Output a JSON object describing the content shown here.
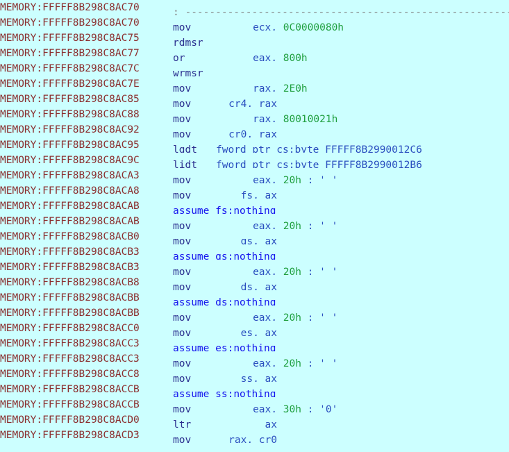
{
  "view": {
    "name": "IDA View disassembly listing",
    "segment": "MEMORY",
    "background_color": "#ccffff",
    "colors": {
      "address": "#8b2f2f",
      "mnemonic": "#2a2f8f",
      "operand": "#2a4fbf",
      "number": "#1f9f3f",
      "directive": "#1515ee",
      "comment": "#808080"
    }
  },
  "lines": [
    {
      "address": "MEMORY:FFFFF8B298C8AC70",
      "kind": "comment",
      "mnemonic": "",
      "operands": "",
      "comment": "; ----------------------------------------------------------"
    },
    {
      "address": "MEMORY:FFFFF8B298C8AC70",
      "kind": "instruction",
      "mnemonic": "mov",
      "operands_reg": "ecx,",
      "operands_num": "0C0000080h",
      "comment": ""
    },
    {
      "address": "MEMORY:FFFFF8B298C8AC75",
      "kind": "instruction",
      "mnemonic": "rdmsr",
      "operands_reg": "",
      "operands_num": "",
      "comment": ""
    },
    {
      "address": "MEMORY:FFFFF8B298C8AC77",
      "kind": "instruction",
      "mnemonic": "or",
      "operands_reg": "eax,",
      "operands_num": "800h",
      "comment": ""
    },
    {
      "address": "MEMORY:FFFFF8B298C8AC7C",
      "kind": "instruction",
      "mnemonic": "wrmsr",
      "operands_reg": "",
      "operands_num": "",
      "comment": ""
    },
    {
      "address": "MEMORY:FFFFF8B298C8AC7E",
      "kind": "instruction",
      "mnemonic": "mov",
      "operands_reg": "rax,",
      "operands_num": "2E0h",
      "comment": ""
    },
    {
      "address": "MEMORY:FFFFF8B298C8AC85",
      "kind": "instruction",
      "mnemonic": "mov",
      "operands_reg": "cr4, rax",
      "operands_num": "",
      "comment": ""
    },
    {
      "address": "MEMORY:FFFFF8B298C8AC88",
      "kind": "instruction",
      "mnemonic": "mov",
      "operands_reg": "rax,",
      "operands_num": "80010021h",
      "comment": ""
    },
    {
      "address": "MEMORY:FFFFF8B298C8AC92",
      "kind": "instruction",
      "mnemonic": "mov",
      "operands_reg": "cr0, rax",
      "operands_num": "",
      "comment": ""
    },
    {
      "address": "MEMORY:FFFFF8B298C8AC95",
      "kind": "instruction",
      "mnemonic": "lgdt",
      "operands_reg": "fword ptr cs:byte_FFFFF8B2990012C6",
      "operands_num": "",
      "comment": ""
    },
    {
      "address": "MEMORY:FFFFF8B298C8AC9C",
      "kind": "instruction",
      "mnemonic": "lidt",
      "operands_reg": "fword ptr cs:byte_FFFFF8B2990012B6",
      "operands_num": "",
      "comment": ""
    },
    {
      "address": "MEMORY:FFFFF8B298C8ACA3",
      "kind": "instruction",
      "mnemonic": "mov",
      "operands_reg": "eax,",
      "operands_num": "20h",
      "comment": "; ' '"
    },
    {
      "address": "MEMORY:FFFFF8B298C8ACA8",
      "kind": "instruction",
      "mnemonic": "mov",
      "operands_reg": "fs, ax",
      "operands_num": "",
      "comment": ""
    },
    {
      "address": "MEMORY:FFFFF8B298C8ACAB",
      "kind": "directive",
      "mnemonic": "assume",
      "operands_reg": "fs:nothing",
      "operands_num": "",
      "comment": ""
    },
    {
      "address": "MEMORY:FFFFF8B298C8ACAB",
      "kind": "instruction",
      "mnemonic": "mov",
      "operands_reg": "eax,",
      "operands_num": "20h",
      "comment": "; ' '"
    },
    {
      "address": "MEMORY:FFFFF8B298C8ACB0",
      "kind": "instruction",
      "mnemonic": "mov",
      "operands_reg": "gs, ax",
      "operands_num": "",
      "comment": ""
    },
    {
      "address": "MEMORY:FFFFF8B298C8ACB3",
      "kind": "directive",
      "mnemonic": "assume",
      "operands_reg": "gs:nothing",
      "operands_num": "",
      "comment": ""
    },
    {
      "address": "MEMORY:FFFFF8B298C8ACB3",
      "kind": "instruction",
      "mnemonic": "mov",
      "operands_reg": "eax,",
      "operands_num": "20h",
      "comment": "; ' '"
    },
    {
      "address": "MEMORY:FFFFF8B298C8ACB8",
      "kind": "instruction",
      "mnemonic": "mov",
      "operands_reg": "ds, ax",
      "operands_num": "",
      "comment": ""
    },
    {
      "address": "MEMORY:FFFFF8B298C8ACBB",
      "kind": "directive",
      "mnemonic": "assume",
      "operands_reg": "ds:nothing",
      "operands_num": "",
      "comment": ""
    },
    {
      "address": "MEMORY:FFFFF8B298C8ACBB",
      "kind": "instruction",
      "mnemonic": "mov",
      "operands_reg": "eax,",
      "operands_num": "20h",
      "comment": "; ' '"
    },
    {
      "address": "MEMORY:FFFFF8B298C8ACC0",
      "kind": "instruction",
      "mnemonic": "mov",
      "operands_reg": "es, ax",
      "operands_num": "",
      "comment": ""
    },
    {
      "address": "MEMORY:FFFFF8B298C8ACC3",
      "kind": "directive",
      "mnemonic": "assume",
      "operands_reg": "es:nothing",
      "operands_num": "",
      "comment": ""
    },
    {
      "address": "MEMORY:FFFFF8B298C8ACC3",
      "kind": "instruction",
      "mnemonic": "mov",
      "operands_reg": "eax,",
      "operands_num": "20h",
      "comment": "; ' '"
    },
    {
      "address": "MEMORY:FFFFF8B298C8ACC8",
      "kind": "instruction",
      "mnemonic": "mov",
      "operands_reg": "ss, ax",
      "operands_num": "",
      "comment": ""
    },
    {
      "address": "MEMORY:FFFFF8B298C8ACCB",
      "kind": "directive",
      "mnemonic": "assume",
      "operands_reg": "ss:nothing",
      "operands_num": "",
      "comment": ""
    },
    {
      "address": "MEMORY:FFFFF8B298C8ACCB",
      "kind": "instruction",
      "mnemonic": "mov",
      "operands_reg": "eax,",
      "operands_num": "30h",
      "comment": "; '0'"
    },
    {
      "address": "MEMORY:FFFFF8B298C8ACD0",
      "kind": "instruction",
      "mnemonic": "ltr",
      "operands_reg": "ax",
      "operands_num": "",
      "comment": ""
    },
    {
      "address": "MEMORY:FFFFF8B298C8ACD3",
      "kind": "instruction",
      "mnemonic": "mov",
      "operands_reg": "rax, cr0",
      "operands_num": "",
      "comment": ""
    }
  ]
}
